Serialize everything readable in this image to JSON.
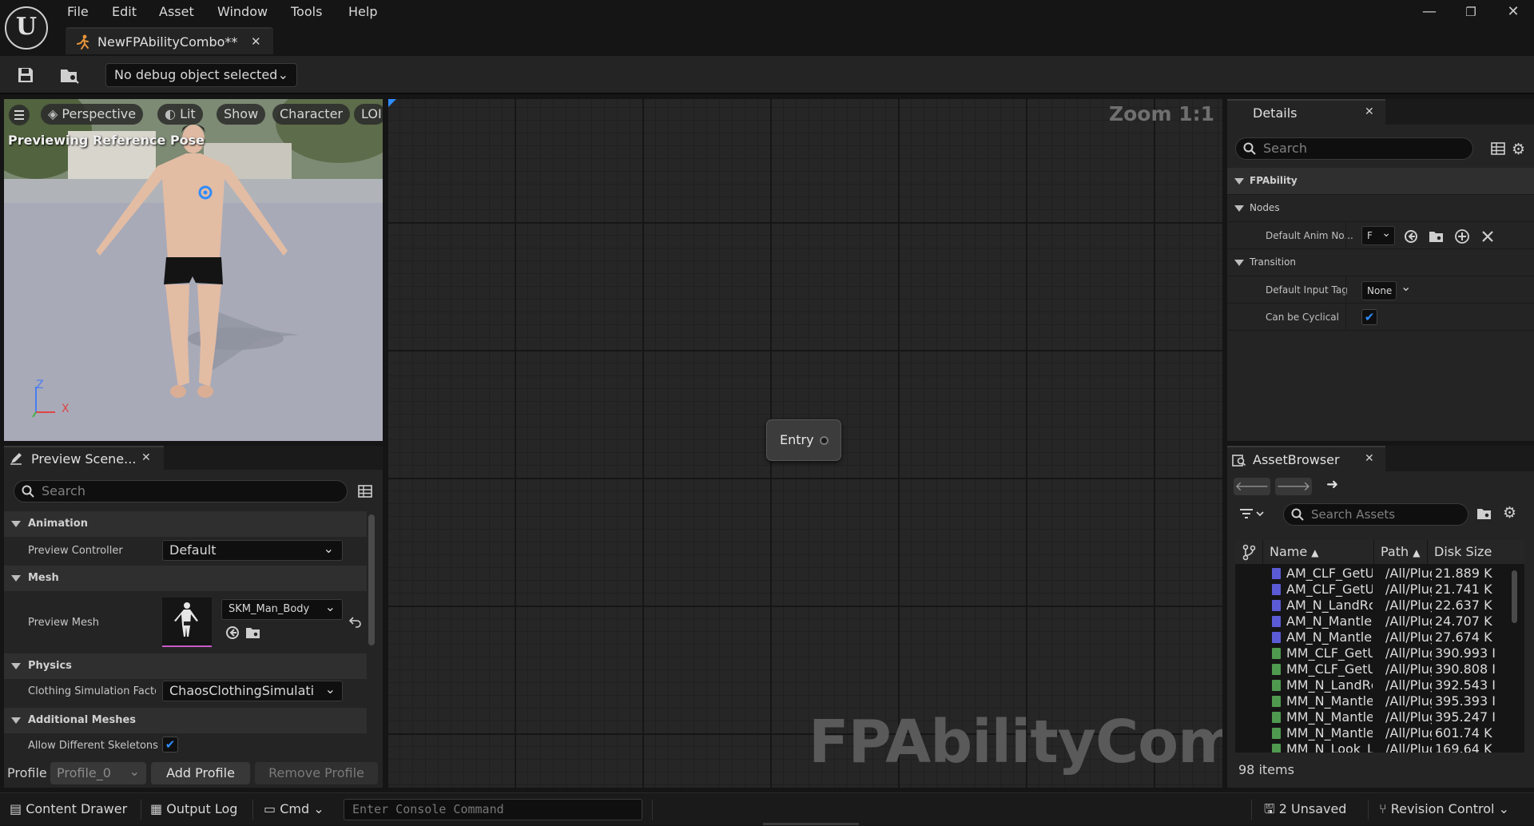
{
  "app": {
    "logo_letter": "U",
    "menu": [
      "File",
      "Edit",
      "Asset",
      "Window",
      "Tools",
      "Help"
    ],
    "document_tab": "NewFPAbilityCombo**",
    "window_controls": {
      "minimize": "—",
      "restore": "❐",
      "close": "✕"
    }
  },
  "toolbar": {
    "debug_object": "No debug object selected"
  },
  "viewport": {
    "buttons": [
      "Perspective",
      "Lit",
      "Show",
      "Character",
      "LOI"
    ],
    "status": "Previewing Reference Pose",
    "axis_z": "Z",
    "axis_x": "X"
  },
  "preview_scene": {
    "tab_label": "Preview Scene...",
    "search_placeholder": "Search",
    "sections": {
      "animation": "Animation",
      "mesh": "Mesh",
      "physics": "Physics",
      "additional_meshes": "Additional Meshes"
    },
    "preview_controller_label": "Preview Controller",
    "preview_controller_value": "Default",
    "preview_mesh_label": "Preview Mesh",
    "preview_mesh_value": "SKM_Man_Body",
    "clothing_factory_label": "Clothing Simulation Factor",
    "clothing_factory_value": "ChaosClothingSimulati",
    "allow_skeletons_label": "Allow Different Skeletons",
    "allow_skeletons_checked": true,
    "profile_label": "Profile",
    "profile_value": "Profile_0",
    "add_profile": "Add Profile",
    "remove_profile": "Remove Profile"
  },
  "graph": {
    "zoom": "Zoom 1:1",
    "entry_node": "Entry",
    "watermark": "FPAbilityCombo"
  },
  "details": {
    "tab_label": "Details",
    "search_placeholder": "Search",
    "category": "FPAbility",
    "nodes_section": "Nodes",
    "default_anim_node_label": "Default Anim No...",
    "default_anim_node_value": "F",
    "transition_section": "Transition",
    "default_input_tag_label": "Default Input Tag",
    "default_input_tag_value": "None",
    "can_be_cyclical_label": "Can be Cyclical",
    "can_be_cyclical_checked": true
  },
  "asset_browser": {
    "tab_label": "AssetBrowser",
    "search_placeholder": "Search Assets",
    "columns": {
      "name": "Name",
      "path": "Path",
      "size": "Disk Size"
    },
    "rows": [
      {
        "name": "AM_CLF_GetU",
        "path": "/All/Plug",
        "size": "21.889 K",
        "kind": "montage"
      },
      {
        "name": "AM_CLF_GetU",
        "path": "/All/Plug",
        "size": "21.741 K",
        "kind": "montage"
      },
      {
        "name": "AM_N_LandRc",
        "path": "/All/Plug",
        "size": "22.637 K",
        "kind": "montage"
      },
      {
        "name": "AM_N_Mantle",
        "path": "/All/Plug",
        "size": "24.707 K",
        "kind": "montage"
      },
      {
        "name": "AM_N_Mantle",
        "path": "/All/Plug",
        "size": "27.674 K",
        "kind": "montage"
      },
      {
        "name": "MM_CLF_GetU",
        "path": "/All/Plug",
        "size": "390.993 I",
        "kind": "sequence"
      },
      {
        "name": "MM_CLF_GetU",
        "path": "/All/Plug",
        "size": "390.808 I",
        "kind": "sequence"
      },
      {
        "name": "MM_N_LandRc",
        "path": "/All/Plug",
        "size": "392.543 I",
        "kind": "sequence"
      },
      {
        "name": "MM_N_Mantle",
        "path": "/All/Plug",
        "size": "395.393 I",
        "kind": "sequence"
      },
      {
        "name": "MM_N_Mantle",
        "path": "/All/Plug",
        "size": "395.247 I",
        "kind": "sequence"
      },
      {
        "name": "MM_N_Mantle",
        "path": "/All/Plug",
        "size": "601.74 K",
        "kind": "sequence"
      },
      {
        "name": "MM_N_Look_L",
        "path": "/All/Plug",
        "size": "169.64 K",
        "kind": "sequence"
      }
    ],
    "item_count": "98 items"
  },
  "statusbar": {
    "content_drawer": "Content Drawer",
    "output_log": "Output Log",
    "cmd": "Cmd",
    "console_placeholder": "Enter Console Command",
    "unsaved": "2 Unsaved",
    "revision_control": "Revision Control"
  },
  "colors": {
    "accent_blue": "#2f8cff",
    "montage_icon": "#5b5bd6",
    "sequence_icon": "#4f9a4f"
  }
}
